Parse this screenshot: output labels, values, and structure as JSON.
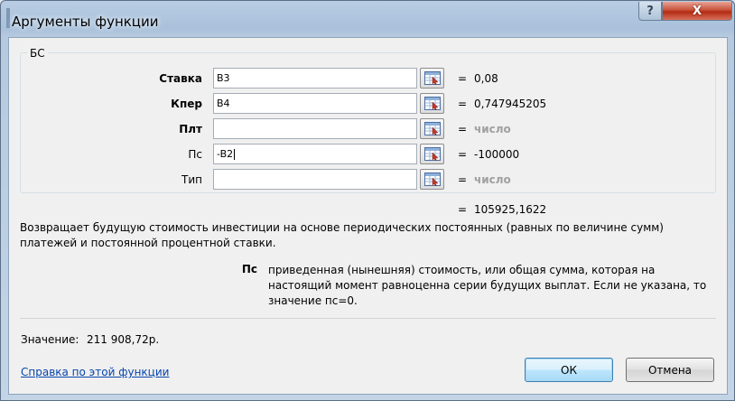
{
  "window": {
    "title": "Аргументы функции",
    "help_glyph": "?",
    "close_glyph": "X"
  },
  "function": {
    "name": "БС"
  },
  "arguments": [
    {
      "label": "Ставка",
      "bold": true,
      "value": "B3",
      "eq": "=",
      "result": "0,08",
      "hint": false
    },
    {
      "label": "Кпер",
      "bold": true,
      "value": "B4",
      "eq": "=",
      "result": "0,747945205",
      "hint": false
    },
    {
      "label": "Плт",
      "bold": true,
      "value": "",
      "eq": "=",
      "result": "число",
      "hint": true
    },
    {
      "label": "Пс",
      "bold": false,
      "value": "-B2",
      "eq": "=",
      "result": "-100000",
      "hint": false
    },
    {
      "label": "Тип",
      "bold": false,
      "value": "",
      "eq": "=",
      "result": "число",
      "hint": true
    }
  ],
  "formula_result": {
    "eq": "=",
    "value": "105925,1622"
  },
  "description": "Возвращает будущую стоимость инвестиции на основе периодических постоянных (равных по величине сумм) платежей и постоянной процентной ставки.",
  "param_help": {
    "name": "Пс",
    "text": "приведенная (нынешняя) стоимость, или общая сумма, которая на настоящий момент равноценна серии будущих выплат. Если не указана, то значение пс=0."
  },
  "value_row": {
    "label": "Значение:",
    "value": "211 908,72р."
  },
  "help_link": "Справка по этой функции",
  "buttons": {
    "ok": "ОК",
    "cancel": "Отмена"
  }
}
